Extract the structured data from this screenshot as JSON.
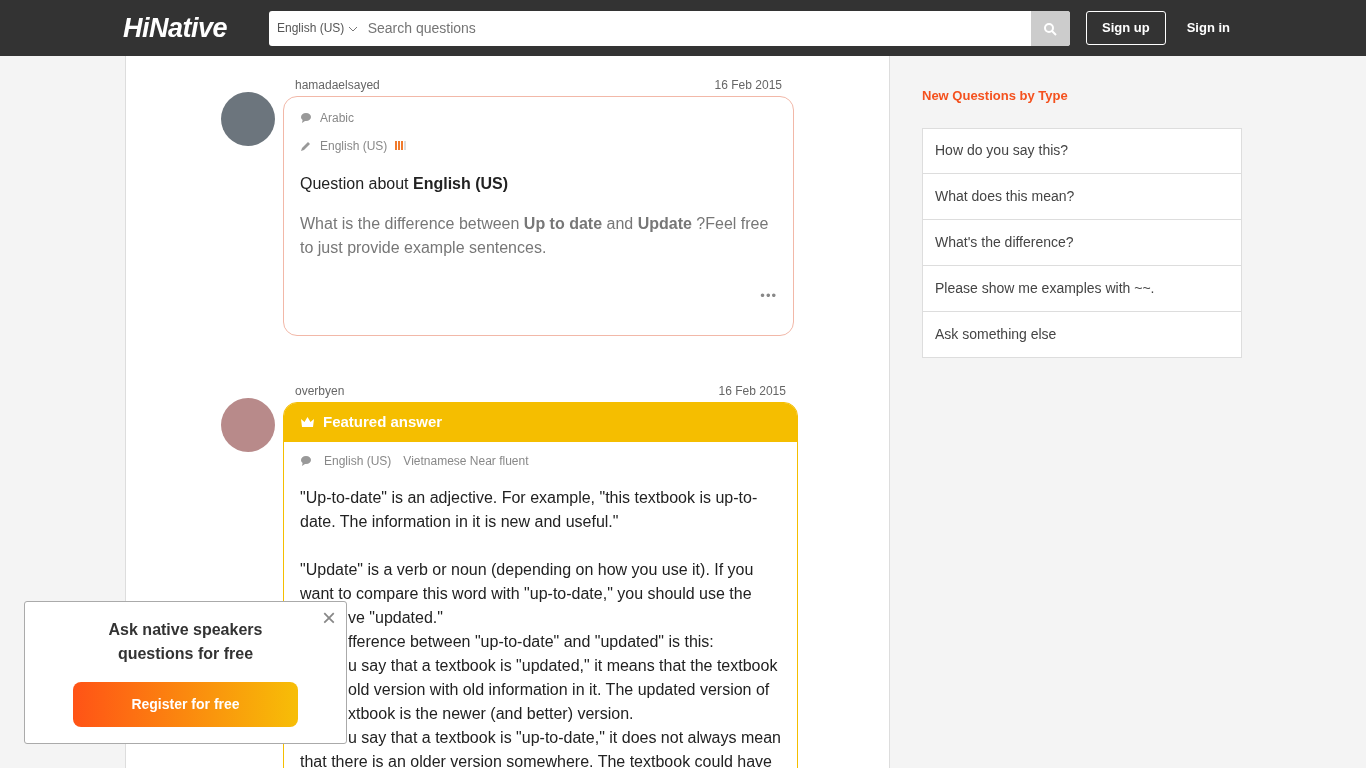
{
  "header": {
    "logo": "HiNative",
    "language": "English (US)",
    "search": {
      "placeholder": "Search questions"
    },
    "sign_up": "Sign up",
    "sign_in": "Sign in"
  },
  "question": {
    "user": "hamadaelsayed",
    "date": "16 Feb 2015",
    "native": "Arabic",
    "learning": "English (US)",
    "proficiency": {
      "level": 0.75
    },
    "title": "Question about **English (US)**",
    "body": "What is the difference between **Up to date** and **Update** ?Feel free to just provide example sentences.",
    "more": "•••"
  },
  "answer": {
    "user": "overbyen",
    "date": "16 Feb 2015",
    "featured": true,
    "featured_label": "Featured answer",
    "languages": [
      "English (US)",
      "Vietnamese Near fluent"
    ],
    "paragraphs": [
      {
        "lines": [
          {
            "text": "\"Up-to-date\" is an adjective. For example, \"this textbook is up-to-",
            "clipped": false
          },
          {
            "text": "date. The information in it is new and useful.\"",
            "clipped": false
          }
        ]
      },
      {
        "lines": [
          {
            "text": "\"Update\" is a verb or noun (depending on how you use it). If you",
            "clipped": false
          },
          {
            "text": "want to compare this word with \"up-to-date,\" you should use the",
            "clipped": false
          },
          {
            "text": "ve \"updated.\"",
            "clipped": true
          },
          {
            "text": "fference between \"up-to-date\" and \"updated\" is this:",
            "clipped": true
          },
          {
            "text": "u say that a textbook is \"updated,\" it means that the textbook",
            "clipped": true
          },
          {
            "text": "old version with old information in it. The updated version of",
            "clipped": true
          },
          {
            "text": "xtbook is the newer (and better) version.",
            "clipped": true
          },
          {
            "text": "u say that a textbook is \"up-to-date,\" it does not always mean",
            "clipped": true
          },
          {
            "text": "that there is an older version somewhere. The textbook could have",
            "clipped": false
          }
        ]
      }
    ]
  },
  "sidebar": {
    "title": "New Questions by Type",
    "items": [
      "How do you say this?",
      "What does this mean?",
      "What's the difference?",
      "Please show me examples with ~~.",
      "Ask something else"
    ]
  },
  "popup": {
    "title": "Ask native speakers questions for free",
    "button": "Register for free",
    "close": "×"
  }
}
